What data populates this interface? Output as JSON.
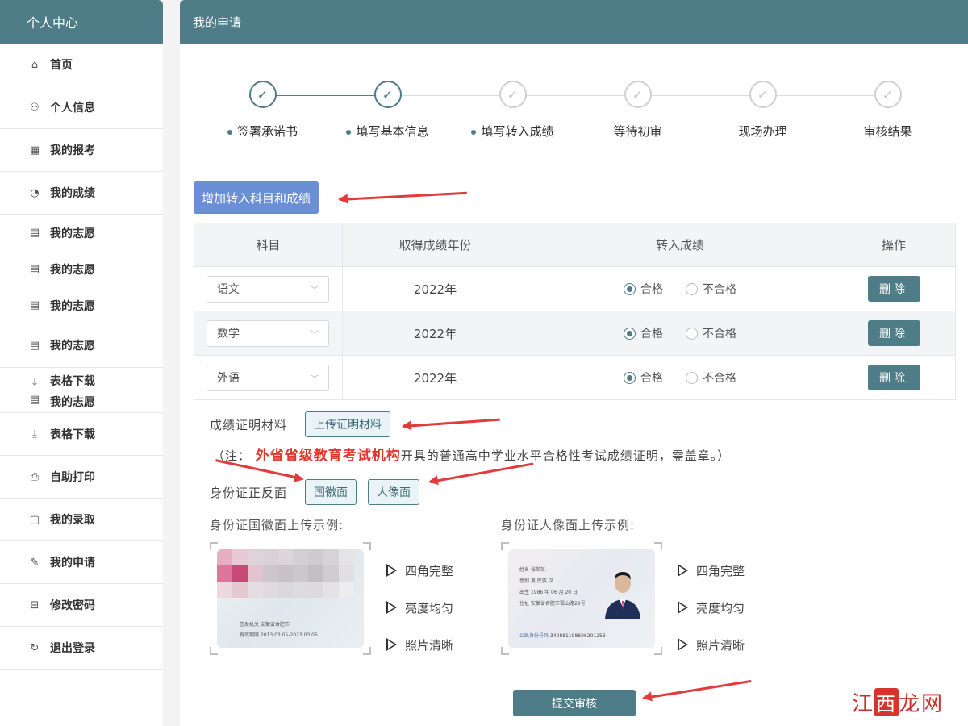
{
  "sidebar": {
    "title": "个人中心",
    "items": [
      {
        "label": "首页",
        "icon": "home-icon"
      },
      {
        "label": "个人信息",
        "icon": "user-icon"
      },
      {
        "label": "我的报考",
        "icon": "calendar-icon"
      },
      {
        "label": "我的成绩",
        "icon": "pie-chart-icon"
      },
      {
        "label": "我的志愿",
        "icon": "document-icon"
      },
      {
        "label": "我的志愿",
        "icon": "document-icon"
      },
      {
        "label": "我的志愿",
        "icon": "document-icon"
      },
      {
        "label": "我的志愿",
        "icon": "document-icon"
      },
      {
        "label": "表格下载",
        "icon": "download-icon"
      },
      {
        "label": "我的志愿",
        "icon": "document-icon"
      },
      {
        "label": "表格下载",
        "icon": "download-icon"
      },
      {
        "label": "自助打印",
        "icon": "printer-icon"
      },
      {
        "label": "我的录取",
        "icon": "calendar-icon"
      },
      {
        "label": "我的申请",
        "icon": "edit-icon"
      },
      {
        "label": "修改密码",
        "icon": "lock-icon"
      },
      {
        "label": "退出登录",
        "icon": "logout-icon"
      }
    ]
  },
  "main": {
    "title": "我的申请",
    "steps": [
      {
        "label": "签署承诺书",
        "status": "done",
        "dot": true
      },
      {
        "label": "填写基本信息",
        "status": "done",
        "dot": true
      },
      {
        "label": "填写转入成绩",
        "status": "todo",
        "dot": true
      },
      {
        "label": "等待初审",
        "status": "todo",
        "dot": false
      },
      {
        "label": "现场办理",
        "status": "todo",
        "dot": false
      },
      {
        "label": "审核结果",
        "status": "todo",
        "dot": false
      }
    ],
    "add_button": "增加转入科目和成绩",
    "table": {
      "headers": [
        "科目",
        "取得成绩年份",
        "转入成绩",
        "操作"
      ],
      "rows": [
        {
          "subject": "语文",
          "year": "2022年",
          "selected": "合格"
        },
        {
          "subject": "数学",
          "year": "2022年",
          "selected": "合格"
        },
        {
          "subject": "外语",
          "year": "2022年",
          "selected": "合格"
        }
      ],
      "option_pass": "合格",
      "option_fail": "不合格",
      "delete_label": "删除"
    },
    "proof_label": "成绩证明材料",
    "upload_proof_button": "上传证明材料",
    "note_prefix": "（注：",
    "note_strong": "外省省级教育考试机构",
    "note_suffix": "开具的普通高中学业水平合格性考试成绩证明，需盖章。）",
    "id_label": "身份证正反面",
    "emblem_button": "国徽面",
    "portrait_button": "人像面",
    "emblem_example_title": "身份证国徽面上传示例:",
    "portrait_example_title": "身份证人像面上传示例:",
    "emblem_card": {
      "authority_label": "签发机关",
      "authority_value": "安徽省合肥市",
      "validity_label": "有效期限",
      "validity_value": "2013.03.05-2023.03.05"
    },
    "portrait_card": {
      "name_label": "姓名",
      "name_value": "张某某",
      "gender_label": "性别",
      "gender_value": "男",
      "ethnicity_label": "民族",
      "ethnicity_value": "汉",
      "birth_label": "出生",
      "birth_value": "1986 年 06 月 20 日",
      "address_label": "住址",
      "address_value": "安徽省合肥市蜀山路29号",
      "id_label": "公民身份号码",
      "id_value": "340881198606201256"
    },
    "checklist": [
      "四角完整",
      "亮度均匀",
      "照片清晰"
    ],
    "submit_button": "提交审核"
  },
  "watermark": {
    "prefix": "江",
    "box": "西",
    "suffix": "龙网"
  },
  "colors": {
    "theme": "#4e7c87",
    "add_button": "#6a8fd6",
    "note_highlight": "#e0362c",
    "arrow": "#e23b3b"
  }
}
